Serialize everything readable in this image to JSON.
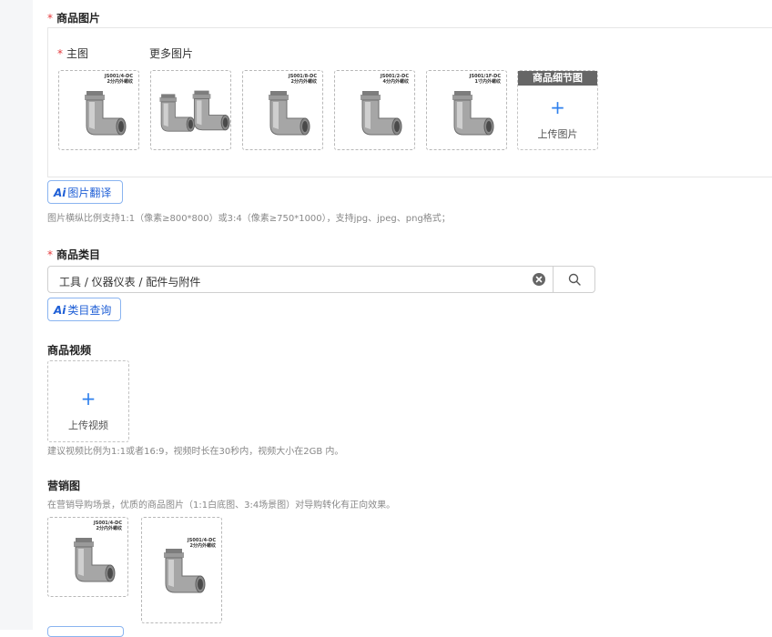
{
  "product_images": {
    "label": "商品图片",
    "main_label": "主图",
    "more_label": "更多图片",
    "detail_tag": "商品细节图",
    "upload_label": "上传图片",
    "thumbnails": [
      {
        "code": "JS001/4-DC",
        "desc": "2分内外螺纹"
      },
      {
        "code": "",
        "desc": ""
      },
      {
        "code": "JS001/8-DC",
        "desc": "2分内外螺纹"
      },
      {
        "code": "JS001/2-DC",
        "desc": "4分内外螺纹"
      },
      {
        "code": "JS001/1F-DC",
        "desc": "1寸内外螺纹"
      }
    ],
    "ai_button": "图片翻译",
    "ai_mark": "Ai",
    "hint": "图片横纵比例支持1:1（像素≥800*800）或3:4（像素≥750*1000），支持jpg、jpeg、png格式；"
  },
  "category": {
    "label": "商品类目",
    "value": "工具 / 仪器仪表 / 配件与附件",
    "ai_button": "类目查询",
    "ai_mark": "Ai"
  },
  "video": {
    "label": "商品视频",
    "upload_label": "上传视频",
    "hint": "建议视频比例为1:1或者16:9，视频时长在30秒内，视频大小在2GB 内。"
  },
  "marketing": {
    "label": "营销图",
    "hint": "在营销导购场景，优质的商品图片（1:1白底图、3:4场景图）对导购转化有正向效果。",
    "thumbnails": [
      {
        "code": "JS001/4-DC",
        "desc": "2分内外螺纹"
      },
      {
        "code": "JS001/4-DC",
        "desc": "2分内外螺纹"
      }
    ]
  },
  "colors": {
    "required": "#e4393c",
    "accent": "#2f80ed",
    "watermark": "#3fb6c8"
  }
}
